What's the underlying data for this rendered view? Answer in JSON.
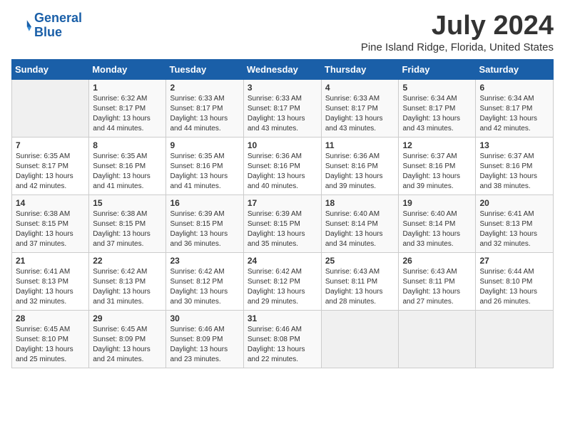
{
  "logo": {
    "line1": "General",
    "line2": "Blue"
  },
  "title": "July 2024",
  "location": "Pine Island Ridge, Florida, United States",
  "headers": [
    "Sunday",
    "Monday",
    "Tuesday",
    "Wednesday",
    "Thursday",
    "Friday",
    "Saturday"
  ],
  "weeks": [
    [
      {
        "day": "",
        "sunrise": "",
        "sunset": "",
        "daylight": ""
      },
      {
        "day": "1",
        "sunrise": "Sunrise: 6:32 AM",
        "sunset": "Sunset: 8:17 PM",
        "daylight": "Daylight: 13 hours and 44 minutes."
      },
      {
        "day": "2",
        "sunrise": "Sunrise: 6:33 AM",
        "sunset": "Sunset: 8:17 PM",
        "daylight": "Daylight: 13 hours and 44 minutes."
      },
      {
        "day": "3",
        "sunrise": "Sunrise: 6:33 AM",
        "sunset": "Sunset: 8:17 PM",
        "daylight": "Daylight: 13 hours and 43 minutes."
      },
      {
        "day": "4",
        "sunrise": "Sunrise: 6:33 AM",
        "sunset": "Sunset: 8:17 PM",
        "daylight": "Daylight: 13 hours and 43 minutes."
      },
      {
        "day": "5",
        "sunrise": "Sunrise: 6:34 AM",
        "sunset": "Sunset: 8:17 PM",
        "daylight": "Daylight: 13 hours and 43 minutes."
      },
      {
        "day": "6",
        "sunrise": "Sunrise: 6:34 AM",
        "sunset": "Sunset: 8:17 PM",
        "daylight": "Daylight: 13 hours and 42 minutes."
      }
    ],
    [
      {
        "day": "7",
        "sunrise": "Sunrise: 6:35 AM",
        "sunset": "Sunset: 8:17 PM",
        "daylight": "Daylight: 13 hours and 42 minutes."
      },
      {
        "day": "8",
        "sunrise": "Sunrise: 6:35 AM",
        "sunset": "Sunset: 8:16 PM",
        "daylight": "Daylight: 13 hours and 41 minutes."
      },
      {
        "day": "9",
        "sunrise": "Sunrise: 6:35 AM",
        "sunset": "Sunset: 8:16 PM",
        "daylight": "Daylight: 13 hours and 41 minutes."
      },
      {
        "day": "10",
        "sunrise": "Sunrise: 6:36 AM",
        "sunset": "Sunset: 8:16 PM",
        "daylight": "Daylight: 13 hours and 40 minutes."
      },
      {
        "day": "11",
        "sunrise": "Sunrise: 6:36 AM",
        "sunset": "Sunset: 8:16 PM",
        "daylight": "Daylight: 13 hours and 39 minutes."
      },
      {
        "day": "12",
        "sunrise": "Sunrise: 6:37 AM",
        "sunset": "Sunset: 8:16 PM",
        "daylight": "Daylight: 13 hours and 39 minutes."
      },
      {
        "day": "13",
        "sunrise": "Sunrise: 6:37 AM",
        "sunset": "Sunset: 8:16 PM",
        "daylight": "Daylight: 13 hours and 38 minutes."
      }
    ],
    [
      {
        "day": "14",
        "sunrise": "Sunrise: 6:38 AM",
        "sunset": "Sunset: 8:15 PM",
        "daylight": "Daylight: 13 hours and 37 minutes."
      },
      {
        "day": "15",
        "sunrise": "Sunrise: 6:38 AM",
        "sunset": "Sunset: 8:15 PM",
        "daylight": "Daylight: 13 hours and 37 minutes."
      },
      {
        "day": "16",
        "sunrise": "Sunrise: 6:39 AM",
        "sunset": "Sunset: 8:15 PM",
        "daylight": "Daylight: 13 hours and 36 minutes."
      },
      {
        "day": "17",
        "sunrise": "Sunrise: 6:39 AM",
        "sunset": "Sunset: 8:15 PM",
        "daylight": "Daylight: 13 hours and 35 minutes."
      },
      {
        "day": "18",
        "sunrise": "Sunrise: 6:40 AM",
        "sunset": "Sunset: 8:14 PM",
        "daylight": "Daylight: 13 hours and 34 minutes."
      },
      {
        "day": "19",
        "sunrise": "Sunrise: 6:40 AM",
        "sunset": "Sunset: 8:14 PM",
        "daylight": "Daylight: 13 hours and 33 minutes."
      },
      {
        "day": "20",
        "sunrise": "Sunrise: 6:41 AM",
        "sunset": "Sunset: 8:13 PM",
        "daylight": "Daylight: 13 hours and 32 minutes."
      }
    ],
    [
      {
        "day": "21",
        "sunrise": "Sunrise: 6:41 AM",
        "sunset": "Sunset: 8:13 PM",
        "daylight": "Daylight: 13 hours and 32 minutes."
      },
      {
        "day": "22",
        "sunrise": "Sunrise: 6:42 AM",
        "sunset": "Sunset: 8:13 PM",
        "daylight": "Daylight: 13 hours and 31 minutes."
      },
      {
        "day": "23",
        "sunrise": "Sunrise: 6:42 AM",
        "sunset": "Sunset: 8:12 PM",
        "daylight": "Daylight: 13 hours and 30 minutes."
      },
      {
        "day": "24",
        "sunrise": "Sunrise: 6:42 AM",
        "sunset": "Sunset: 8:12 PM",
        "daylight": "Daylight: 13 hours and 29 minutes."
      },
      {
        "day": "25",
        "sunrise": "Sunrise: 6:43 AM",
        "sunset": "Sunset: 8:11 PM",
        "daylight": "Daylight: 13 hours and 28 minutes."
      },
      {
        "day": "26",
        "sunrise": "Sunrise: 6:43 AM",
        "sunset": "Sunset: 8:11 PM",
        "daylight": "Daylight: 13 hours and 27 minutes."
      },
      {
        "day": "27",
        "sunrise": "Sunrise: 6:44 AM",
        "sunset": "Sunset: 8:10 PM",
        "daylight": "Daylight: 13 hours and 26 minutes."
      }
    ],
    [
      {
        "day": "28",
        "sunrise": "Sunrise: 6:45 AM",
        "sunset": "Sunset: 8:10 PM",
        "daylight": "Daylight: 13 hours and 25 minutes."
      },
      {
        "day": "29",
        "sunrise": "Sunrise: 6:45 AM",
        "sunset": "Sunset: 8:09 PM",
        "daylight": "Daylight: 13 hours and 24 minutes."
      },
      {
        "day": "30",
        "sunrise": "Sunrise: 6:46 AM",
        "sunset": "Sunset: 8:09 PM",
        "daylight": "Daylight: 13 hours and 23 minutes."
      },
      {
        "day": "31",
        "sunrise": "Sunrise: 6:46 AM",
        "sunset": "Sunset: 8:08 PM",
        "daylight": "Daylight: 13 hours and 22 minutes."
      },
      {
        "day": "",
        "sunrise": "",
        "sunset": "",
        "daylight": ""
      },
      {
        "day": "",
        "sunrise": "",
        "sunset": "",
        "daylight": ""
      },
      {
        "day": "",
        "sunrise": "",
        "sunset": "",
        "daylight": ""
      }
    ]
  ]
}
